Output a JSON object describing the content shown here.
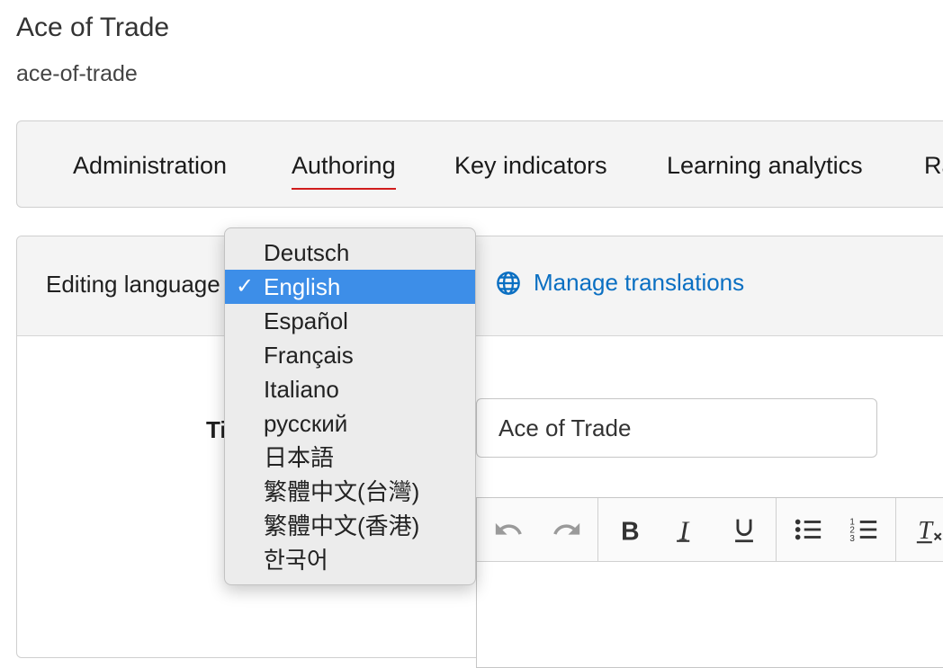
{
  "header": {
    "title": "Ace of Trade",
    "slug": "ace-of-trade"
  },
  "tabs": [
    {
      "label": "Administration",
      "active": false
    },
    {
      "label": "Authoring",
      "active": true
    },
    {
      "label": "Key indicators",
      "active": false
    },
    {
      "label": "Learning analytics",
      "active": false
    },
    {
      "label": "Ra",
      "active": false
    }
  ],
  "colors": {
    "active_tab_underline": "#d01c1c",
    "link": "#0a6fc2",
    "selected_option": "#3d8ee8"
  },
  "editing": {
    "label": "Editing language",
    "selected_language": "English",
    "manage_translations": "Manage translations",
    "manage_icon": "globe-icon"
  },
  "language_options": [
    {
      "label": "Deutsch",
      "selected": false
    },
    {
      "label": "English",
      "selected": true,
      "check": "✓"
    },
    {
      "label": "Español",
      "selected": false
    },
    {
      "label": "Français",
      "selected": false
    },
    {
      "label": "Italiano",
      "selected": false
    },
    {
      "label": "русский",
      "selected": false
    },
    {
      "label": "日本語",
      "selected": false
    },
    {
      "label": "繁體中文(台灣)",
      "selected": false
    },
    {
      "label": "繁體中文(香港)",
      "selected": false
    },
    {
      "label": "한국어",
      "selected": false
    }
  ],
  "form": {
    "title_label_visible": "Ti",
    "title_value": "Ace of Trade"
  },
  "editor_toolbar": [
    {
      "icon": "undo-icon"
    },
    {
      "icon": "redo-icon"
    },
    {
      "icon": "bold-icon"
    },
    {
      "icon": "italic-icon"
    },
    {
      "icon": "underline-icon"
    },
    {
      "icon": "bulleted-list-icon"
    },
    {
      "icon": "numbered-list-icon"
    },
    {
      "icon": "clear-formatting-icon"
    }
  ]
}
